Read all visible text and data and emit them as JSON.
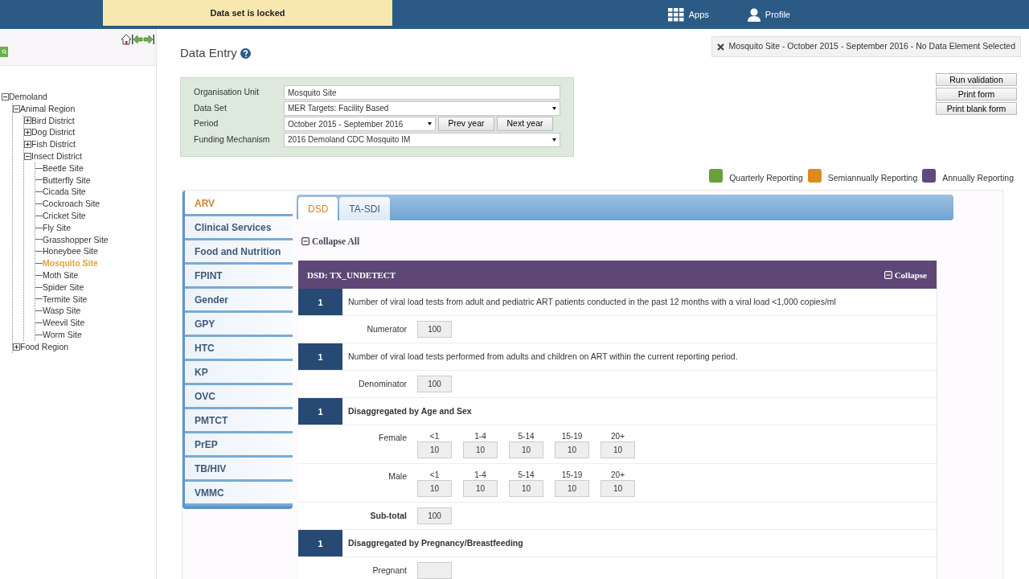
{
  "top_bar": {
    "notice": "Data set is locked",
    "menu": [
      {
        "label": "Apps",
        "kind": "apps"
      },
      {
        "label": "Profile",
        "kind": "profile"
      }
    ]
  },
  "tree": [
    {
      "label": "Demoland",
      "expanded": true,
      "selected": false,
      "children": [
        {
          "label": "Animal Region",
          "expanded": true,
          "selected": false,
          "children": [
            {
              "label": "Bird District",
              "expanded": false,
              "selected": false
            },
            {
              "label": "Dog District",
              "expanded": false,
              "selected": false
            },
            {
              "label": "Fish District",
              "expanded": false,
              "selected": false
            },
            {
              "label": "Insect District",
              "expanded": true,
              "selected": false,
              "children": [
                {
                  "label": "Beetle Site",
                  "selected": false
                },
                {
                  "label": "Butterfly Site",
                  "selected": false
                },
                {
                  "label": "Cicada Site",
                  "selected": false
                },
                {
                  "label": "Cockroach Site",
                  "selected": false
                },
                {
                  "label": "Cricket Site",
                  "selected": false
                },
                {
                  "label": "Fly Site",
                  "selected": false
                },
                {
                  "label": "Grasshopper Site",
                  "selected": false
                },
                {
                  "label": "Honeybee Site",
                  "selected": false
                },
                {
                  "label": "Mosquito Site",
                  "selected": true
                },
                {
                  "label": "Moth Site",
                  "selected": false
                },
                {
                  "label": "Spider Site",
                  "selected": false
                },
                {
                  "label": "Termite Site",
                  "selected": false
                },
                {
                  "label": "Wasp Site",
                  "selected": false
                },
                {
                  "label": "Weevil Site",
                  "selected": false
                },
                {
                  "label": "Worm Site",
                  "selected": false
                }
              ]
            }
          ]
        },
        {
          "label": "Food Region",
          "expanded": false,
          "selected": false
        }
      ]
    }
  ],
  "title": "Data Entry",
  "form": {
    "fields": [
      {
        "label": "Organisation Unit",
        "value": "Mosquito Site",
        "kind": "text"
      },
      {
        "label": "Data Set",
        "value": "MER Targets: Facility Based",
        "kind": "select"
      },
      {
        "label": "Period",
        "value": "October 2015 - September 2016",
        "kind": "select",
        "buttons": [
          "Prev year",
          "Next year"
        ]
      },
      {
        "label": "Funding Mechanism",
        "value": "2016 Demoland CDC Mosquito IM",
        "kind": "select"
      }
    ]
  },
  "context": "Mosquito Site - October 2015 - September 2016 - No Data Element Selected",
  "actions": [
    "Run validation",
    "Print form",
    "Print blank form"
  ],
  "legend": [
    {
      "label": "Quarterly Reporting",
      "color": "#6a9f3a"
    },
    {
      "label": "Semiannually Reporting",
      "color": "#e08a1e"
    },
    {
      "label": "Annually Reporting",
      "color": "#5e4a7d"
    }
  ],
  "section_tabs": [
    {
      "label": "ARV",
      "selected": true
    },
    {
      "label": "Clinical Services",
      "selected": false
    },
    {
      "label": "Food and Nutrition",
      "selected": false
    },
    {
      "label": "FPINT",
      "selected": false
    },
    {
      "label": "Gender",
      "selected": false
    },
    {
      "label": "GPY",
      "selected": false
    },
    {
      "label": "HTC",
      "selected": false
    },
    {
      "label": "KP",
      "selected": false
    },
    {
      "label": "OVC",
      "selected": false
    },
    {
      "label": "PMTCT",
      "selected": false
    },
    {
      "label": "PrEP",
      "selected": false
    },
    {
      "label": "TB/HIV",
      "selected": false
    },
    {
      "label": "VMMC",
      "selected": false
    }
  ],
  "sub_tabs": [
    {
      "label": "DSD",
      "selected": true
    },
    {
      "label": "TA-SDI",
      "selected": false
    }
  ],
  "collapse_all": "Collapse All",
  "section": {
    "title": "DSD: TX_UNDETECT",
    "collapse": "Collapse",
    "rows": [
      {
        "kind": "element",
        "number": "1",
        "text": "Number of viral load tests from adult and pediatric ART patients conducted in the past 12 months with a viral load <1,000 copies/ml",
        "bold": false
      },
      {
        "kind": "value",
        "label": "Numerator",
        "value": "100",
        "bold": false
      },
      {
        "kind": "element",
        "number": "1",
        "text": "Number of viral load tests performed from adults and children on ART within the current reporting period.",
        "bold": false
      },
      {
        "kind": "value",
        "label": "Denominator",
        "value": "100",
        "bold": false
      },
      {
        "kind": "element",
        "number": "1",
        "text": "Disaggregated by Age and Sex",
        "bold": true
      },
      {
        "kind": "grid",
        "label": "Female",
        "cells": [
          {
            "header": "<1",
            "value": "10"
          },
          {
            "header": "1-4",
            "value": "10"
          },
          {
            "header": "5-14",
            "value": "10"
          },
          {
            "header": "15-19",
            "value": "10"
          },
          {
            "header": "20+",
            "value": "10"
          }
        ]
      },
      {
        "kind": "grid",
        "label": "Male",
        "cells": [
          {
            "header": "<1",
            "value": "10"
          },
          {
            "header": "1-4",
            "value": "10"
          },
          {
            "header": "5-14",
            "value": "10"
          },
          {
            "header": "15-19",
            "value": "10"
          },
          {
            "header": "20+",
            "value": "10"
          }
        ]
      },
      {
        "kind": "value",
        "label": "Sub-total",
        "value": "100",
        "bold": true
      },
      {
        "kind": "element",
        "number": "1",
        "text": "Disaggregated by Pregnancy/Breastfeeding",
        "bold": true
      },
      {
        "kind": "value",
        "label": "Pregnant",
        "bold": false
      }
    ]
  }
}
